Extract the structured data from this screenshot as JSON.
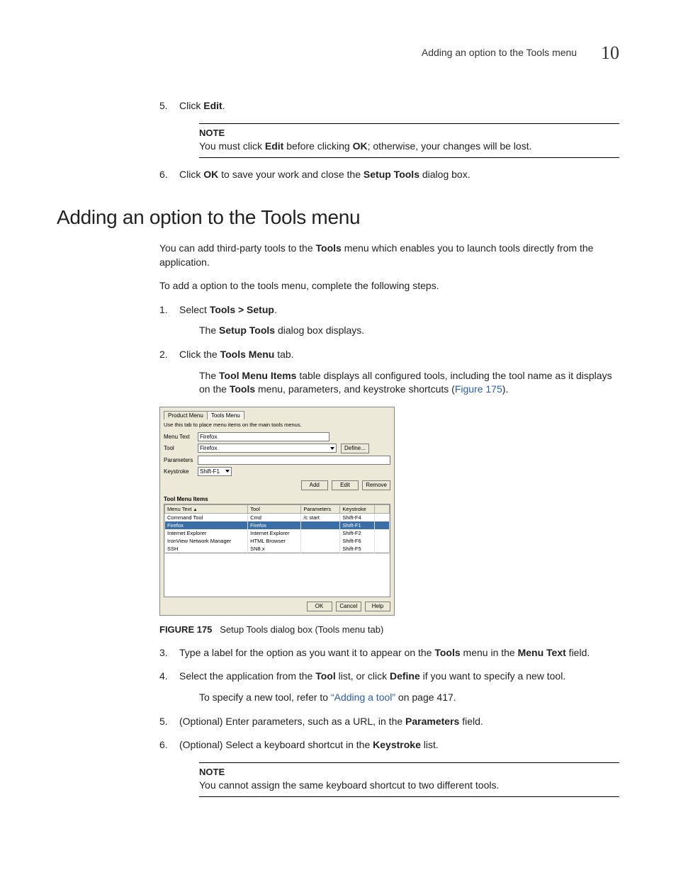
{
  "header": {
    "running_title": "Adding an option to the Tools menu",
    "chapter_number": "10"
  },
  "pre_section": {
    "step5": {
      "num": "5.",
      "text_a": "Click ",
      "bold_a": "Edit",
      "text_b": "."
    },
    "note1": {
      "label": "NOTE",
      "p1": "You must click ",
      "b1": "Edit",
      "p2": " before clicking ",
      "b2": "OK",
      "p3": "; otherwise, your changes will be lost."
    },
    "step6": {
      "num": "6.",
      "p1": "Click ",
      "b1": "OK",
      "p2": " to save your work and close the ",
      "b2": "Setup Tools",
      "p3": " dialog box."
    }
  },
  "section_title": "Adding an option to the Tools menu",
  "intro": {
    "p1a": "You can add third-party tools to the ",
    "p1b": "Tools",
    "p1c": " menu which enables you to launch tools directly from the application.",
    "p2": "To add a option to the tools menu, complete the following steps."
  },
  "steps": {
    "s1": {
      "num": "1.",
      "a": "Select ",
      "b": "Tools > Setup",
      "c": ".",
      "sub_a": "The ",
      "sub_b": "Setup Tools",
      "sub_c": " dialog box displays."
    },
    "s2": {
      "num": "2.",
      "a": "Click the ",
      "b": "Tools Menu",
      "c": " tab.",
      "sub_a": "The ",
      "sub_b": "Tool Menu Items",
      "sub_c": " table displays all configured tools, including the tool name as it displays on the ",
      "sub_d": "Tools",
      "sub_e": " menu, parameters, and keystroke shortcuts (",
      "sub_link": "Figure 175",
      "sub_f": ")."
    },
    "s3": {
      "num": "3.",
      "a": "Type a label for the option as you want it to appear on the ",
      "b": "Tools",
      "c": " menu in the ",
      "d": "Menu Text",
      "e": " field."
    },
    "s4": {
      "num": "4.",
      "a": "Select the application from the ",
      "b": "Tool",
      "c": " list, or click ",
      "d": "Define",
      "e": " if you want to specify a new tool.",
      "sub_a": "To specify a new tool, refer to ",
      "sub_link": "“Adding a tool”",
      "sub_b": " on page 417."
    },
    "s5": {
      "num": "5.",
      "a": "(Optional) Enter parameters, such as a URL, in the ",
      "b": "Parameters",
      "c": " field."
    },
    "s6": {
      "num": "6.",
      "a": "(Optional) Select a keyboard shortcut in the ",
      "b": "Keystroke",
      "c": " list."
    }
  },
  "note2": {
    "label": "NOTE",
    "text": "You cannot assign the same keyboard shortcut to two different tools."
  },
  "figure": {
    "caption_label": "FIGURE 175",
    "caption_text": "Setup Tools dialog box (Tools menu tab)"
  },
  "dialog": {
    "tabs": {
      "product": "Product Menu",
      "tools": "Tools Menu"
    },
    "hint": "Use this tab to place menu items on the main tools menus.",
    "labels": {
      "menu_text": "Menu Text",
      "tool": "Tool",
      "parameters": "Parameters",
      "keystroke": "Keystroke"
    },
    "values": {
      "menu_text": "Firefox",
      "tool": "Firefox",
      "parameters": "",
      "keystroke": "Shift-F1"
    },
    "buttons": {
      "define": "Define...",
      "add": "Add",
      "edit": "Edit",
      "remove": "Remove",
      "ok": "OK",
      "cancel": "Cancel",
      "help": "Help"
    },
    "table_title": "Tool Menu Items",
    "table_headers": {
      "menu_text": "Menu Text",
      "tool": "Tool",
      "parameters": "Parameters",
      "keystroke": "Keystroke"
    },
    "table_rows": [
      {
        "menu_text": "Command Tool",
        "tool": "Cmd",
        "parameters": "/c start",
        "keystroke": "Shift-F4",
        "selected": false
      },
      {
        "menu_text": "Firefox",
        "tool": "Firefox",
        "parameters": "",
        "keystroke": "Shift-F1",
        "selected": true
      },
      {
        "menu_text": "Internet Explorer",
        "tool": "Internet Explorer",
        "parameters": "",
        "keystroke": "Shift-F2",
        "selected": false
      },
      {
        "menu_text": "IronView Network Manager",
        "tool": "HTML Browser",
        "parameters": "",
        "keystroke": "Shift-F6",
        "selected": false
      },
      {
        "menu_text": "SSH",
        "tool": "SN8.x",
        "parameters": "",
        "keystroke": "Shift-F5",
        "selected": false
      }
    ]
  }
}
